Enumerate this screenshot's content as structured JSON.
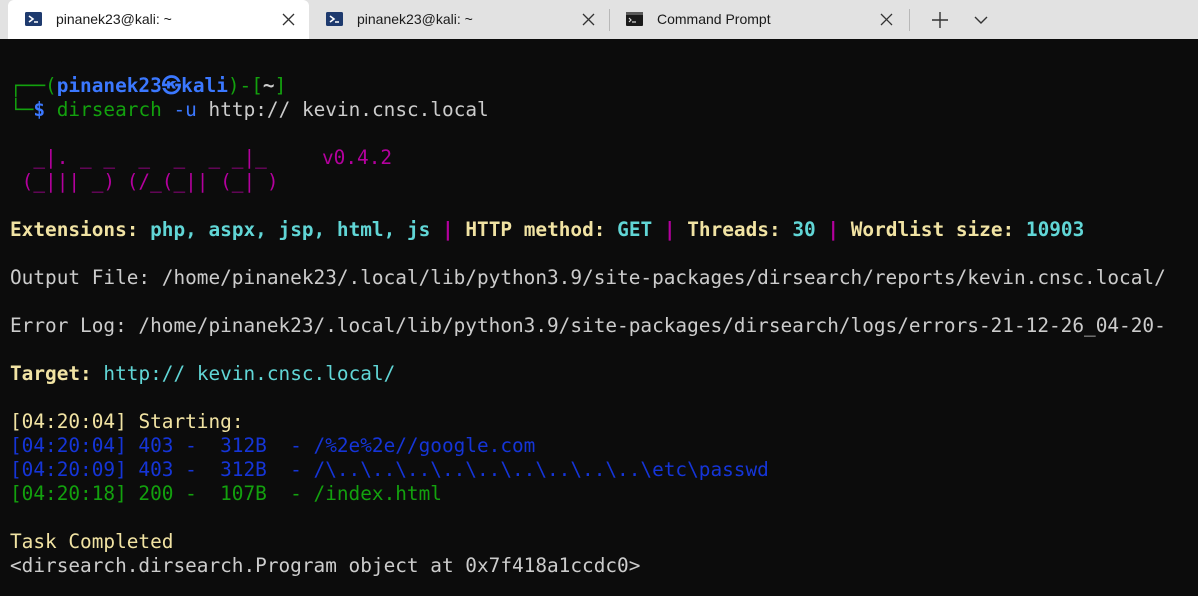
{
  "tabs": [
    {
      "title": "pinanek23@kali: ~",
      "icon": "powershell-icon",
      "active": true
    },
    {
      "title": "pinanek23@kali: ~",
      "icon": "powershell-icon",
      "active": false
    },
    {
      "title": "Command Prompt",
      "icon": "cmd-icon",
      "active": false
    }
  ],
  "prompt": {
    "corner_top": "┌──(",
    "user": "pinanek23",
    "at": "㉿",
    "host": "kali",
    "mid": ")-[",
    "dir": "~",
    "end": "]",
    "corner_bottom": "└─",
    "dollar": "$",
    "command": "dirsearch",
    "flag": "-u",
    "url": "http:// kevin.cnsc.local"
  },
  "banner": {
    "line1": "  _|. _ _  _  _  _ _|_",
    "line2": " (_||| _) (/_(_|| (_| )",
    "version": "v0.4.2"
  },
  "config": {
    "extensions_label": "Extensions:",
    "extensions_value": "php, aspx, jsp, html, js",
    "sep": "|",
    "method_label": "HTTP method:",
    "method_value": "GET",
    "threads_label": "Threads:",
    "threads_value": "30",
    "wordlist_label": "Wordlist size:",
    "wordlist_value": "10903"
  },
  "output_file": "Output File: /home/pinanek23/.local/lib/python3.9/site-packages/dirsearch/reports/kevin.cnsc.local/",
  "error_log": "Error Log: /home/pinanek23/.local/lib/python3.9/site-packages/dirsearch/logs/errors-21-12-26_04-20-",
  "target": {
    "label": "Target:",
    "value": "http:// kevin.cnsc.local/"
  },
  "starting": {
    "time": "[04:20:04]",
    "text": "Starting:"
  },
  "results": [
    {
      "text": "[04:20:04] 403 -  312B  - /%2e%2e//google.com",
      "color": "#1535d8"
    },
    {
      "text": "[04:20:09] 403 -  312B  - /\\..\\..\\..\\..\\..\\..\\..\\..\\..\\etc\\passwd",
      "color": "#1535d8"
    },
    {
      "text": "[04:20:18] 200 -  107B  - /index.html",
      "color": "#13a10e"
    }
  ],
  "task_completed": "Task Completed",
  "object_repr": "<dirsearch.dirsearch.Program object at 0x7f418a1ccdc0>"
}
